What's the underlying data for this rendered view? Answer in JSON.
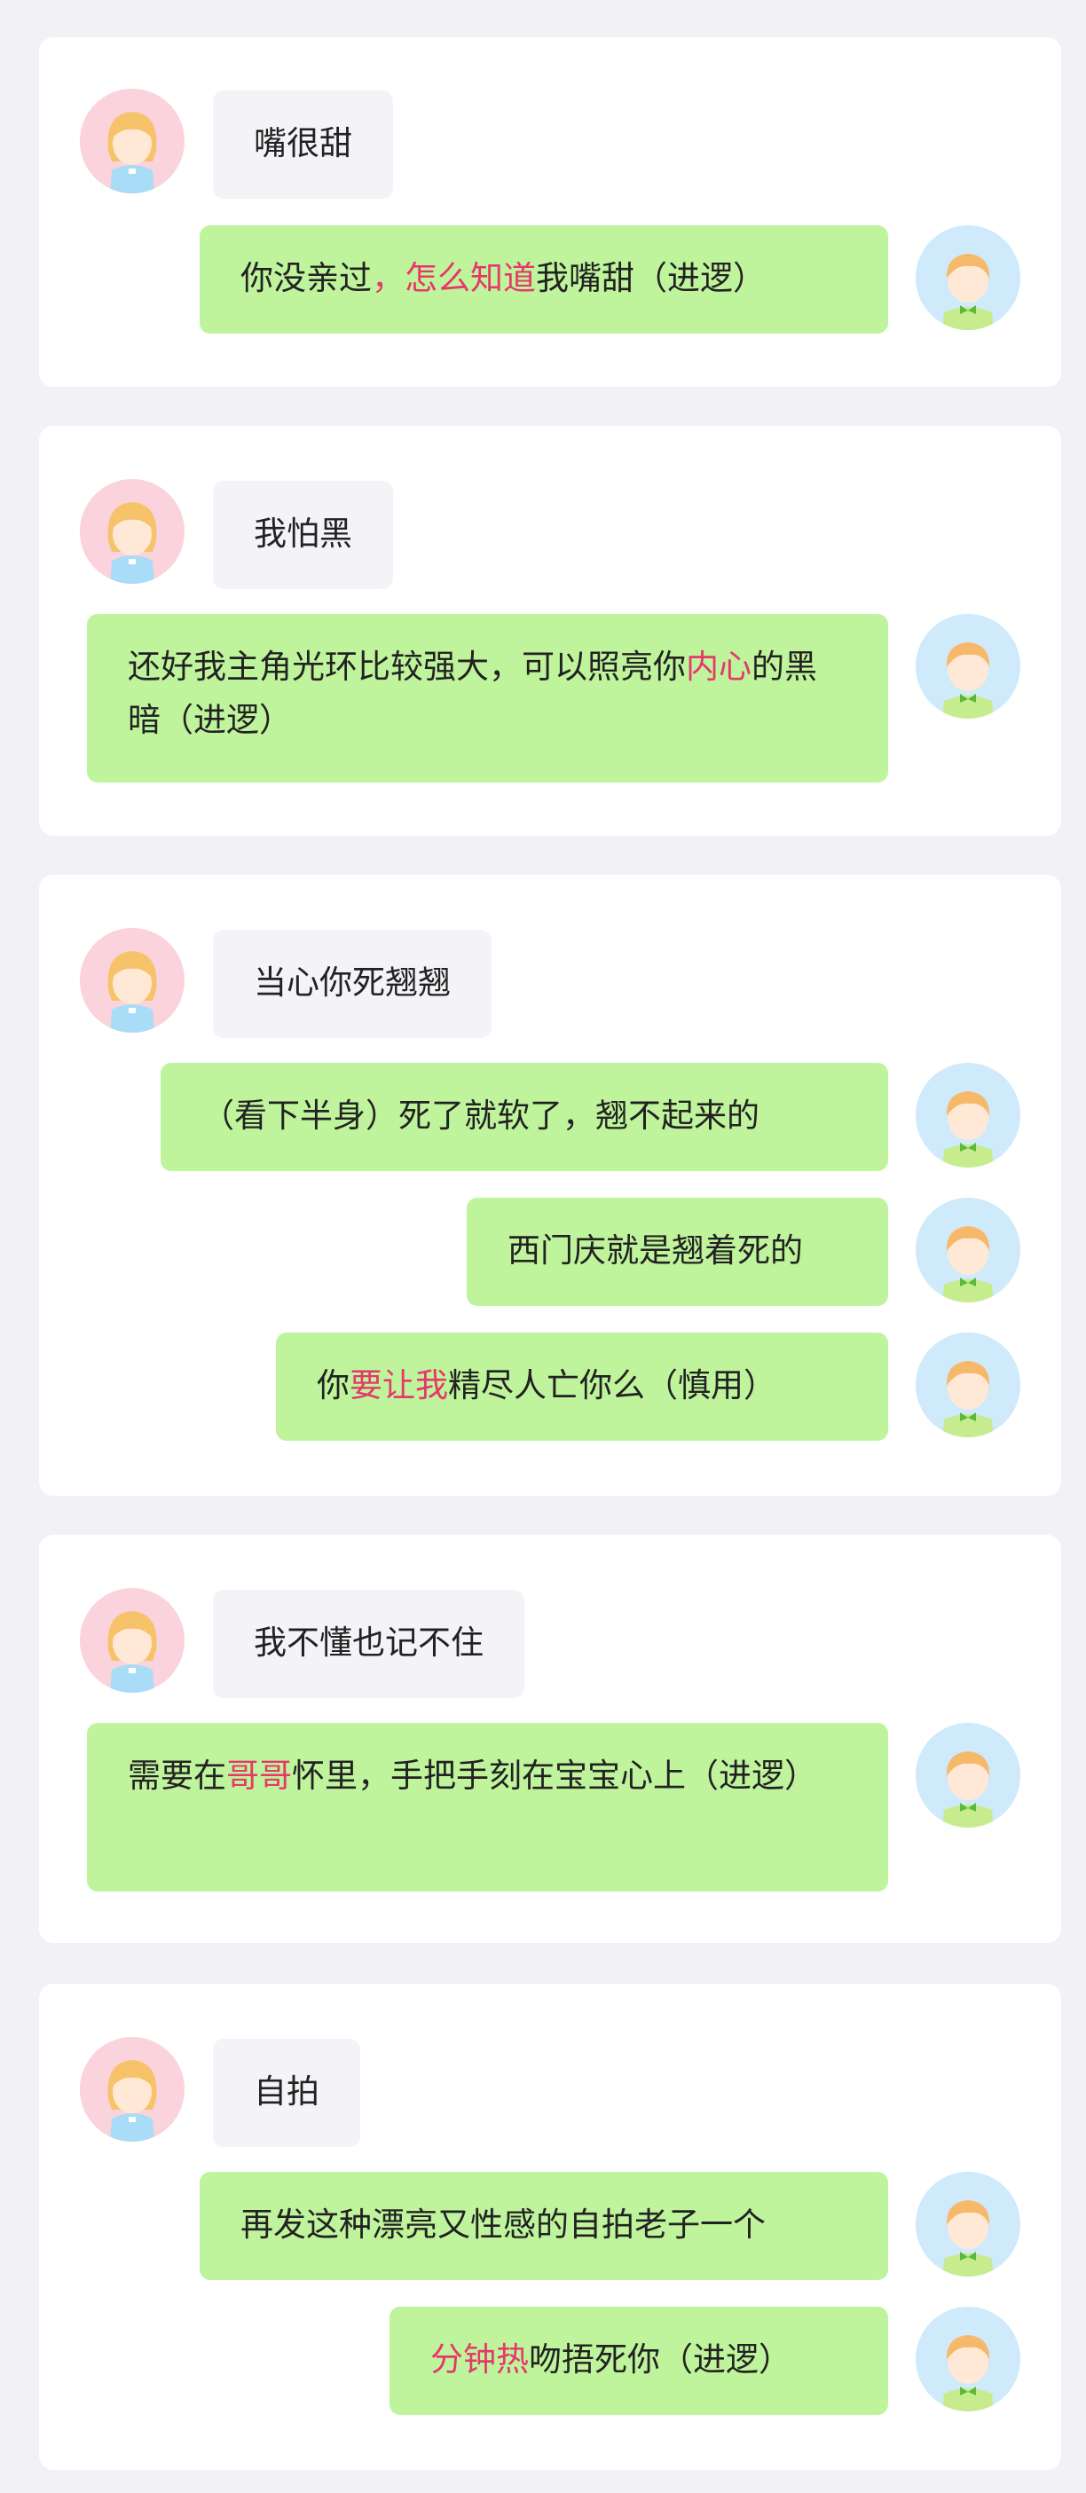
{
  "colors": {
    "page_bg": "#f2f1f5",
    "card_bg": "#ffffff",
    "her_bubble": "#f4f3f7",
    "him_bubble": "#bff49c",
    "highlight": "#e5386b",
    "her_avatar_bg": "#fbd3dc",
    "him_avatar_bg": "#cfeafb"
  },
  "cards": [
    {
      "her": "嘴很甜",
      "replies": [
        {
          "parts": [
            "你没亲过",
            "，怎么知道",
            "我嘴甜（进逻）"
          ]
        }
      ]
    },
    {
      "her": "我怕黑",
      "replies": [
        {
          "parts": [
            "还好我主角光环比较强大，可以照亮你",
            "内心",
            "的黑暗（进逻）"
          ]
        }
      ]
    },
    {
      "her": "当心你死翘翘",
      "replies": [
        {
          "parts": [
            "（看下半身）死了就软了，翘不起来的"
          ]
        },
        {
          "parts": [
            "西门庆就是翘着死的"
          ]
        },
        {
          "parts": [
            "你",
            "要让我",
            "精尽人亡你么（慎用）"
          ]
        }
      ]
    },
    {
      "her": "我不懂也记不住",
      "replies": [
        {
          "parts": [
            "需要在",
            "哥哥",
            "怀里，手把手刻在宝宝心上（进逻）"
          ]
        }
      ]
    },
    {
      "her": "自拍",
      "replies": [
        {
          "parts": [
            "再发这种漂亮又性感的自拍老子一个"
          ]
        },
        {
          "parts": [
            "",
            "分钟热",
            "吻捂死你（进逻）"
          ]
        }
      ]
    }
  ]
}
